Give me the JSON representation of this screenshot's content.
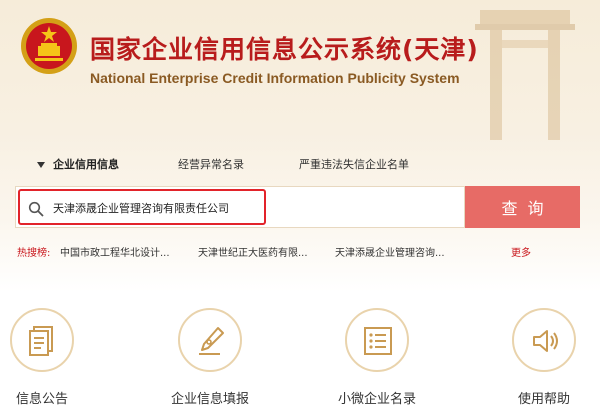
{
  "header": {
    "title_cn": "国家企业信用信息公示系统(天津)",
    "title_en": "National Enterprise Credit Information Publicity System"
  },
  "tabs": [
    {
      "label": "企业信用信息",
      "active": true
    },
    {
      "label": "经营异常名录",
      "active": false
    },
    {
      "label": "严重违法失信企业名单",
      "active": false
    }
  ],
  "search": {
    "value": "天津添晟企业管理咨询有限责任公司",
    "button_label": "查询"
  },
  "hot_search": {
    "label": "热搜榜:",
    "items": [
      "中国市政工程华北设计...",
      "天津世纪正大医药有限...",
      "天津添晟企业管理咨询..."
    ],
    "more_label": "更多"
  },
  "features": [
    {
      "label": "信息公告",
      "icon": "document-icon"
    },
    {
      "label": "企业信息填报",
      "icon": "pen-icon"
    },
    {
      "label": "小微企业名录",
      "icon": "list-icon"
    },
    {
      "label": "使用帮助",
      "icon": "speaker-icon"
    }
  ],
  "colors": {
    "brand_red": "#b81c1c",
    "search_button": "#e76b66",
    "highlight_border": "#e2232a",
    "subtitle_brown": "#8a5a23",
    "icon_gold": "#c99a52"
  }
}
